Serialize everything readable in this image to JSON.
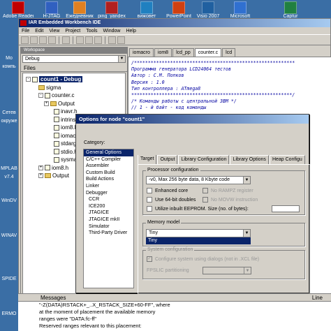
{
  "desktop": {
    "top_icons": [
      "Adobe Reader 9",
      "H-JTAG",
      "Ежедневник",
      "ping_yandex",
      "вижовет",
      "PowerPoint",
      "Visio 2007",
      "Microsoft",
      "Captur"
    ],
    "left_icons": [
      "Mo",
      "компь",
      "Сетев",
      "окруже",
      "MPLAB",
      "v7.4",
      "WinDV",
      "WINAV",
      "SPIDE",
      "ERMO"
    ]
  },
  "ide": {
    "title": "IAR Embedded Workbench IDE",
    "menu": [
      "File",
      "Edit",
      "View",
      "Project",
      "Tools",
      "Window",
      "Help"
    ]
  },
  "workspace": {
    "header": "Workspace",
    "config": "Debug",
    "files_label": "Files",
    "tree": [
      {
        "label": "count1 - Debug",
        "type": "project",
        "toggle": "-"
      },
      {
        "label": "sigma",
        "type": "folder",
        "toggle": ""
      },
      {
        "label": "counter.c",
        "type": "file",
        "toggle": "-"
      },
      {
        "label": "Output",
        "type": "folder",
        "toggle": "+"
      },
      {
        "label": "inavr.h",
        "type": "file",
        "toggle": ""
      },
      {
        "label": "intrinsics.",
        "type": "file",
        "toggle": ""
      },
      {
        "label": "iom8.h",
        "type": "file",
        "toggle": ""
      },
      {
        "label": "iomacro.h",
        "type": "file",
        "toggle": ""
      },
      {
        "label": "stdarg.h",
        "type": "file",
        "toggle": ""
      },
      {
        "label": "stdio.h",
        "type": "file",
        "toggle": ""
      },
      {
        "label": "sysmac.h",
        "type": "file",
        "toggle": ""
      },
      {
        "label": "iom8.h",
        "type": "file",
        "toggle": "+"
      },
      {
        "label": "Output",
        "type": "folder",
        "toggle": "+"
      }
    ],
    "bottom_tab": "count1"
  },
  "editor": {
    "tabs": [
      "iomacro",
      "iom8",
      "lcd_pp",
      "counter.c",
      "lcd"
    ],
    "active_tab": 3,
    "lines": [
      "/**********************************************************",
      "Программа генератора LCD24064 тестов",
      "Автор   : С.М. Попков",
      "Версия  : 1.0",
      "Тип контроллера    : ATmega8",
      "**********************************************************/",
      "/* Команды работы с центральной ЗВМ */",
      "// 1 - й байт - код команды"
    ]
  },
  "messages": {
    "title": "Messages",
    "line_header": "Line",
    "lines": [
      "\"-Z(DATA)RSTACK+_..X_RSTACK_SIZE+60-FF\", where",
      "at the moment of placement the available memory",
      "ranges were \"DATA:fc-ff\"",
      "   Reserved ranges relevant to this placement:"
    ]
  },
  "dialog": {
    "title": "Options for node \"count1\"",
    "category_label": "Category:",
    "categories": [
      {
        "label": "General Options",
        "selected": true,
        "sub": false
      },
      {
        "label": "C/C++ Compiler",
        "selected": false,
        "sub": false
      },
      {
        "label": "Assembler",
        "selected": false,
        "sub": false
      },
      {
        "label": "Custom Build",
        "selected": false,
        "sub": false
      },
      {
        "label": "Build Actions",
        "selected": false,
        "sub": false
      },
      {
        "label": "Linker",
        "selected": false,
        "sub": false
      },
      {
        "label": "Debugger",
        "selected": false,
        "sub": false
      },
      {
        "label": "CCR",
        "selected": false,
        "sub": true
      },
      {
        "label": "ICE200",
        "selected": false,
        "sub": true
      },
      {
        "label": "JTAGICE",
        "selected": false,
        "sub": true
      },
      {
        "label": "JTAGICE mkII",
        "selected": false,
        "sub": true
      },
      {
        "label": "Simulator",
        "selected": false,
        "sub": true
      },
      {
        "label": "Third-Party Driver",
        "selected": false,
        "sub": true
      }
    ],
    "tabs": [
      "Target",
      "Output",
      "Library Configuration",
      "Library Options",
      "Heap Configu"
    ],
    "active_tab": 0,
    "processor_config": {
      "label": "Processor configuration",
      "value": "-v0, Max 256 byte data, 8 Kbyte code"
    },
    "checks_left": [
      {
        "label": "Enhanced core",
        "checked": false,
        "disabled": false
      },
      {
        "label": "Use 64-bit doubles",
        "checked": false,
        "disabled": false
      },
      {
        "label": "Utilize inbuilt EEPROM. Size (no. of bytes):",
        "checked": false,
        "disabled": false
      }
    ],
    "checks_right": [
      {
        "label": "No RAMPZ register",
        "checked": false,
        "disabled": true
      },
      {
        "label": "No MOVW instruction",
        "checked": false,
        "disabled": true
      }
    ],
    "memory_model": {
      "label": "Memory model",
      "value": "Tiny",
      "options": [
        "Tiny"
      ]
    },
    "system_config": {
      "label": "System configuration",
      "check_label": "Configure system using dialogs (not in .XCL file)",
      "fpslic_label": "FPSLIC partitioning"
    }
  }
}
